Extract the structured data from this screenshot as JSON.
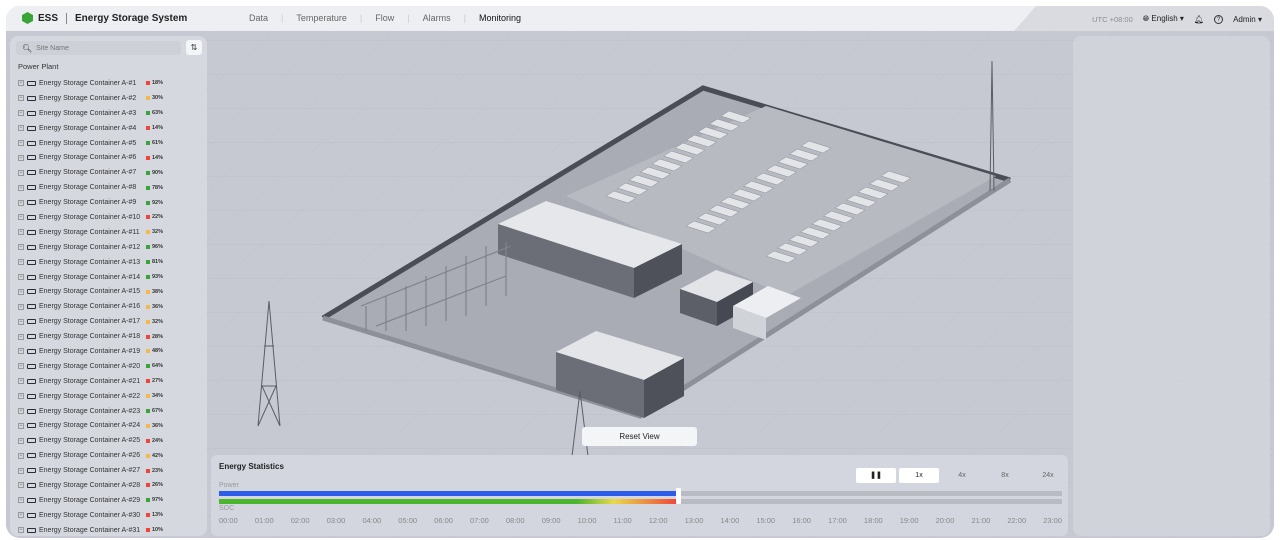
{
  "header": {
    "logo": "ESS",
    "title": "Energy Storage System",
    "nav": [
      "Data",
      "Temperature",
      "Flow",
      "Alarms",
      "Monitoring"
    ],
    "active_nav": "Monitoring",
    "timezone": "UTC +08:00",
    "language": "English",
    "user": "Admin"
  },
  "sidebar": {
    "search_placeholder": "Site Name",
    "group": "Power Plant",
    "items": [
      {
        "name": "Energy Storage Container A-#1",
        "soc": "18%",
        "level": "low"
      },
      {
        "name": "Energy Storage Container A-#2",
        "soc": "30%",
        "level": "mid"
      },
      {
        "name": "Energy Storage Container A-#3",
        "soc": "63%",
        "level": "high"
      },
      {
        "name": "Energy Storage Container A-#4",
        "soc": "14%",
        "level": "low"
      },
      {
        "name": "Energy Storage Container A-#5",
        "soc": "61%",
        "level": "high"
      },
      {
        "name": "Energy Storage Container A-#6",
        "soc": "14%",
        "level": "low"
      },
      {
        "name": "Energy Storage Container A-#7",
        "soc": "90%",
        "level": "high"
      },
      {
        "name": "Energy Storage Container A-#8",
        "soc": "78%",
        "level": "high"
      },
      {
        "name": "Energy Storage Container A-#9",
        "soc": "92%",
        "level": "high"
      },
      {
        "name": "Energy Storage Container A-#10",
        "soc": "22%",
        "level": "low"
      },
      {
        "name": "Energy Storage Container A-#11",
        "soc": "32%",
        "level": "mid"
      },
      {
        "name": "Energy Storage Container A-#12",
        "soc": "96%",
        "level": "high"
      },
      {
        "name": "Energy Storage Container A-#13",
        "soc": "81%",
        "level": "high"
      },
      {
        "name": "Energy Storage Container A-#14",
        "soc": "93%",
        "level": "high"
      },
      {
        "name": "Energy Storage Container A-#15",
        "soc": "38%",
        "level": "mid"
      },
      {
        "name": "Energy Storage Container A-#16",
        "soc": "36%",
        "level": "mid"
      },
      {
        "name": "Energy Storage Container A-#17",
        "soc": "32%",
        "level": "mid"
      },
      {
        "name": "Energy Storage Container A-#18",
        "soc": "28%",
        "level": "low"
      },
      {
        "name": "Energy Storage Container A-#19",
        "soc": "48%",
        "level": "mid"
      },
      {
        "name": "Energy Storage Container A-#20",
        "soc": "64%",
        "level": "high"
      },
      {
        "name": "Energy Storage Container A-#21",
        "soc": "27%",
        "level": "low"
      },
      {
        "name": "Energy Storage Container A-#22",
        "soc": "34%",
        "level": "mid"
      },
      {
        "name": "Energy Storage Container A-#23",
        "soc": "67%",
        "level": "high"
      },
      {
        "name": "Energy Storage Container A-#24",
        "soc": "36%",
        "level": "mid"
      },
      {
        "name": "Energy Storage Container A-#25",
        "soc": "24%",
        "level": "low"
      },
      {
        "name": "Energy Storage Container A-#26",
        "soc": "42%",
        "level": "mid"
      },
      {
        "name": "Energy Storage Container A-#27",
        "soc": "23%",
        "level": "low"
      },
      {
        "name": "Energy Storage Container A-#28",
        "soc": "26%",
        "level": "low"
      },
      {
        "name": "Energy Storage Container A-#29",
        "soc": "97%",
        "level": "high"
      },
      {
        "name": "Energy Storage Container A-#30",
        "soc": "13%",
        "level": "low"
      },
      {
        "name": "Energy Storage Container A-#31",
        "soc": "10%",
        "level": "low"
      }
    ]
  },
  "colors": {
    "low": "#f04438",
    "mid": "#f5b84a",
    "high": "#3aa537",
    "power": "#2f5bea",
    "soc": "#4cb52e",
    "accent": "#3aa537"
  },
  "scene": {
    "reset_label": "Reset View"
  },
  "stats": {
    "title": "Energy Statistics",
    "power_label": "Power",
    "soc_label": "SOC",
    "pause_icon": "pause-icon",
    "speeds": [
      "1x",
      "4x",
      "8x",
      "24x"
    ],
    "active_speed": "1x",
    "progress": 0.545,
    "hours": [
      "00:00",
      "01:00",
      "02:00",
      "03:00",
      "04:00",
      "05:00",
      "06:00",
      "07:00",
      "08:00",
      "09:00",
      "10:00",
      "11:00",
      "12:00",
      "13:00",
      "14:00",
      "15:00",
      "16:00",
      "17:00",
      "18:00",
      "19:00",
      "20:00",
      "21:00",
      "22:00",
      "23:00"
    ]
  }
}
